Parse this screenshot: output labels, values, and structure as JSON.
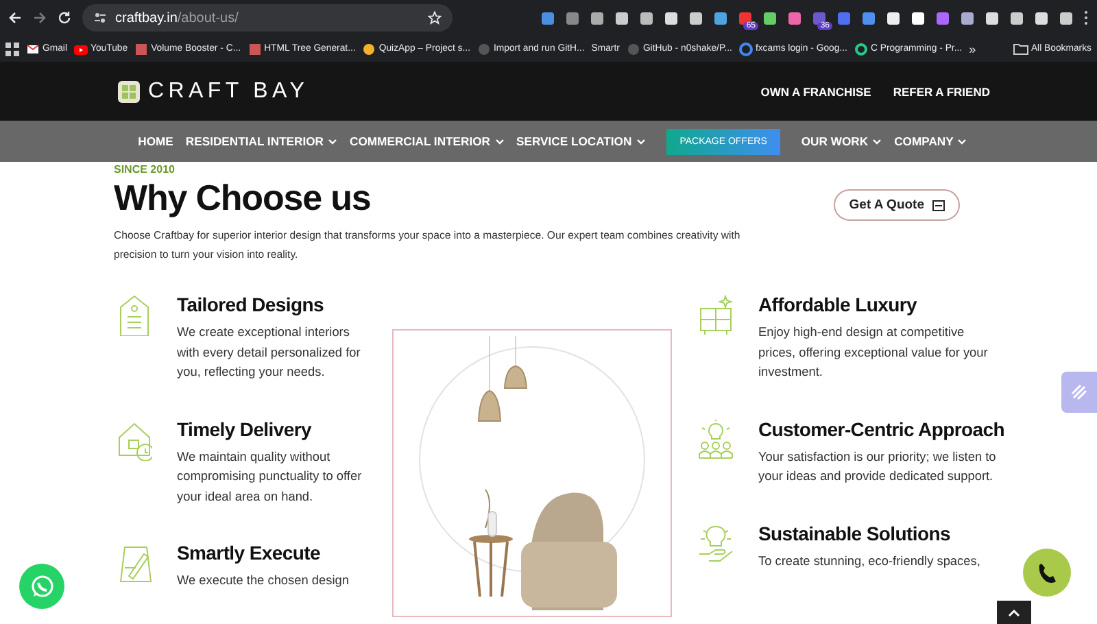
{
  "browser": {
    "url_host": "craftbay.in",
    "url_path": "/about-us/",
    "bookmarks": [
      {
        "label": "Gmail",
        "kind": "mail"
      },
      {
        "label": "YouTube",
        "kind": "video"
      },
      {
        "label": "Volume Booster - C...",
        "kind": "page"
      },
      {
        "label": "HTML Tree Generat...",
        "kind": "page"
      },
      {
        "label": "QuizApp – Project s...",
        "kind": "hand"
      },
      {
        "label": "Import and run GitH...",
        "kind": "dot"
      },
      {
        "label": "Smartr",
        "kind": "none"
      },
      {
        "label": "GitHub - n0shake/P...",
        "kind": "dot"
      },
      {
        "label": "fxcams login - Goog...",
        "kind": "google"
      },
      {
        "label": "C Programming - Pr...",
        "kind": "ring"
      }
    ],
    "more": "»",
    "all_bookmarks": "All Bookmarks",
    "badges": [
      "65",
      "36"
    ]
  },
  "header": {
    "logo": "CRAFT BAY",
    "links": [
      "OWN A FRANCHISE",
      "REFER A FRIEND"
    ]
  },
  "nav": [
    {
      "label": "HOME",
      "kind": "link"
    },
    {
      "label": "RESIDENTIAL INTERIOR",
      "kind": "dropdown"
    },
    {
      "label": "COMMERCIAL INTERIOR",
      "kind": "dropdown"
    },
    {
      "label": "SERVICE LOCATION",
      "kind": "dropdown"
    },
    {
      "label": "PACKAGE OFFERS",
      "kind": "highlight"
    },
    {
      "label": "OUR WORK",
      "kind": "dropdown"
    },
    {
      "label": "COMPANY",
      "kind": "dropdown"
    }
  ],
  "intro": {
    "since": "SINCE 2010",
    "heading": "Why Choose us",
    "text": "Choose Craftbay for superior interior design that transforms your space into a masterpiece. Our expert team combines creativity with precision to turn your vision into reality.",
    "quote_button": "Get A Quote"
  },
  "features_left": [
    {
      "kind": "tag",
      "title": "Tailored Designs",
      "text": "We create exceptional interiors with every detail personalized for you, reflecting your needs."
    },
    {
      "kind": "house",
      "title": "Timely Delivery",
      "text": "We maintain quality without compromising punctuality to offer your ideal area on hand."
    },
    {
      "kind": "pencil",
      "title": "Smartly Execute",
      "text": "We execute the chosen design"
    }
  ],
  "features_right": [
    {
      "kind": "cabinet",
      "title": "Affordable Luxury",
      "text": "Enjoy high-end design at competitive prices, offering exceptional value for your investment."
    },
    {
      "kind": "people",
      "title": "Customer-Centric Approach",
      "text": "Your satisfaction is our priority; we listen to your ideas and provide dedicated support."
    },
    {
      "kind": "bulb",
      "title": "Sustainable Solutions",
      "text": "To create stunning, eco-friendly spaces,"
    }
  ]
}
